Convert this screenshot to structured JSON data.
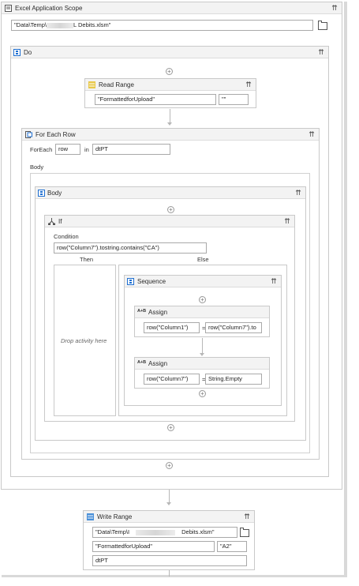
{
  "excel_scope": {
    "title": "Excel Application Scope",
    "path_prefix": "\"Data\\Temp\\",
    "path_suffix": "L Debits.xlsm\""
  },
  "do": {
    "title": "Do"
  },
  "read_range": {
    "title": "Read Range",
    "sheet": "\"FormattedforUpload\"",
    "range": "\"\""
  },
  "for_each": {
    "title": "For Each Row",
    "foreach_label": "ForEach",
    "item": "row",
    "in_label": "in",
    "collection": "dtPT",
    "body_label": "Body"
  },
  "body": {
    "title": "Body"
  },
  "if": {
    "title": "If",
    "condition_label": "Condition",
    "condition": "row(\"Column7\").tostring.contains(\"CA\")",
    "then_label": "Then",
    "else_label": "Else",
    "drop_hint": "Drop activity here"
  },
  "sequence": {
    "title": "Sequence"
  },
  "assign1": {
    "title": "Assign",
    "to": "row(\"Column1\")",
    "eq": "=",
    "value": "row(\"Column7\").to"
  },
  "assign2": {
    "title": "Assign",
    "to": "row(\"Column7\")",
    "eq": "=",
    "value": "String.Empty"
  },
  "write_range": {
    "title": "Write Range",
    "path_prefix": "\"Data\\Temp\\I",
    "path_suffix": "Debits.xlsm\"",
    "sheet": "\"FormattedforUpload\"",
    "start": "\"A2\"",
    "datatable": "dtPT"
  },
  "icons": {
    "collapse": "⇈",
    "expand_plus": "+",
    "assign_glyph": "A+B"
  },
  "colors": {
    "sequence_blue": "#1f6fd1",
    "read_range_yellow": "#e8c84a",
    "write_range_blue": "#4a90d9"
  }
}
